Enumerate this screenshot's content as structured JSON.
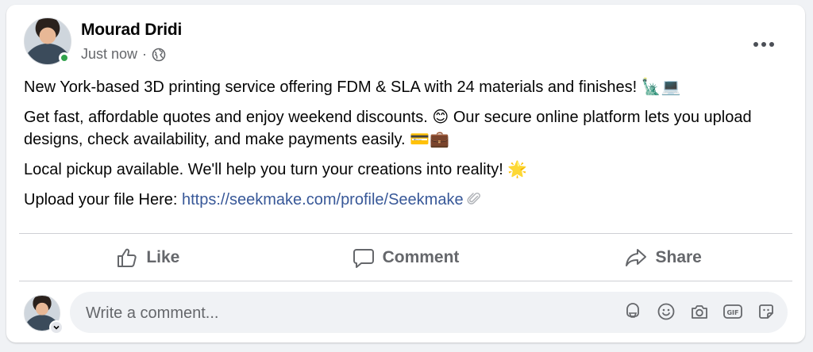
{
  "post": {
    "author": "Mourad Dridi",
    "time": "Just now",
    "separator": "·",
    "paragraphs": {
      "p1": "New York-based 3D printing service offering FDM & SLA with 24 materials and finishes! 🗽💻",
      "p2": "Get fast, affordable quotes and enjoy weekend discounts. 😊 Our secure online platform lets you upload designs, check availability, and make payments easily. 💳💼",
      "p3": "Local pickup available. We'll help you turn your creations into reality! 🌟",
      "p4_prefix": "Upload your file Here: ",
      "p4_link": "https://seekmake.com/profile/Seekmake"
    }
  },
  "actions": {
    "like": "Like",
    "comment": "Comment",
    "share": "Share"
  },
  "comment_box": {
    "placeholder": "Write a comment..."
  },
  "icons": {
    "privacy": "globe-icon",
    "more": "more-options-icon",
    "like": "thumbs-up-icon",
    "comment": "speech-bubble-icon",
    "share": "share-arrow-icon",
    "link": "paperclip-link-icon",
    "avatar_switch": "chevron-down-icon",
    "tools": [
      "avatar-sticker-icon",
      "emoji-icon",
      "camera-icon",
      "gif-icon",
      "sticker-icon"
    ]
  },
  "colors": {
    "link": "#385898",
    "secondary_text": "#65676b",
    "online": "#31a24c"
  }
}
